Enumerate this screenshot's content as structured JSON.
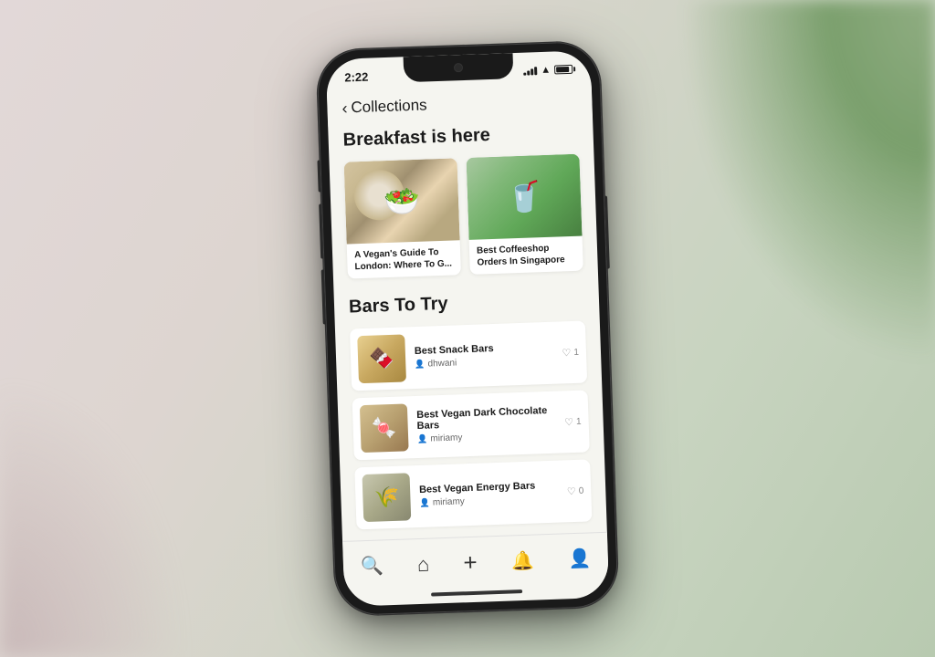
{
  "scene": {
    "background": "#d8cece"
  },
  "status_bar": {
    "time": "2:22",
    "signal_bars": [
      3,
      5,
      7,
      9,
      11
    ],
    "wifi": "wifi",
    "battery": "battery"
  },
  "nav_header": {
    "back_label": "‹",
    "title": "Collections"
  },
  "sections": [
    {
      "id": "breakfast",
      "heading": "Breakfast is here",
      "type": "grid",
      "items": [
        {
          "id": "vegan-guide",
          "label": "A Vegan's Guide To London: Where To G...",
          "thumb_type": "food-1"
        },
        {
          "id": "coffeeshop",
          "label": "Best Coffeeshop Orders In Singapore",
          "thumb_type": "food-2"
        }
      ]
    },
    {
      "id": "bars",
      "heading": "Bars To Try",
      "type": "list",
      "items": [
        {
          "id": "snack-bars",
          "title": "Best Snack Bars",
          "author": "dhwani",
          "likes": 1,
          "thumb_type": "thumb-1"
        },
        {
          "id": "dark-choc",
          "title": "Best Vegan Dark Chocolate Bars",
          "author": "miriamy",
          "likes": 1,
          "thumb_type": "thumb-2"
        },
        {
          "id": "energy-bars",
          "title": "Best Vegan Energy Bars",
          "author": "miriamy",
          "likes": 0,
          "thumb_type": "thumb-3"
        }
      ]
    }
  ],
  "bottom_nav": {
    "items": [
      {
        "id": "search",
        "icon": "🔍",
        "active": true,
        "label": "Search"
      },
      {
        "id": "home",
        "icon": "⌂",
        "active": false,
        "label": "Home"
      },
      {
        "id": "add",
        "icon": "+",
        "active": false,
        "label": "Add"
      },
      {
        "id": "notifications",
        "icon": "🔔",
        "active": false,
        "label": "Notifications"
      },
      {
        "id": "profile",
        "icon": "👤",
        "active": false,
        "label": "Profile"
      }
    ]
  }
}
